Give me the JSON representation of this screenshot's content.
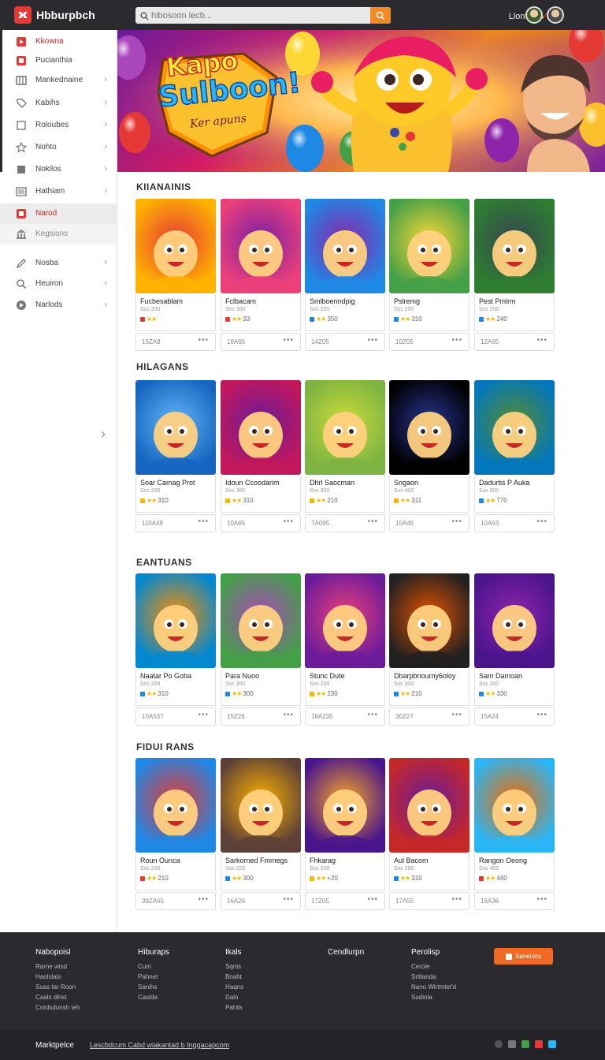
{
  "header": {
    "logo_text": "Hbburpbch",
    "search_placeholder": "hibosoon lecb...",
    "top_link": "Llonws",
    "accent_color": "#f08a24"
  },
  "sidebar": {
    "items": [
      {
        "label": "Kkowna",
        "icon": "play-icon"
      },
      {
        "label": "Pucianthia",
        "icon": "store-icon"
      },
      {
        "label": "Mankednaine",
        "icon": "grid-icon"
      },
      {
        "label": "Kabihs",
        "icon": "tag-icon"
      },
      {
        "label": "Roloubes",
        "icon": "box-icon"
      },
      {
        "label": "Nohto",
        "icon": "star-icon"
      },
      {
        "label": "Nokilos",
        "icon": "square-icon"
      },
      {
        "label": "Hathiam",
        "icon": "image-icon"
      },
      {
        "label": "Narod",
        "icon": "flag-icon"
      },
      {
        "label": "Kegsions",
        "icon": "bank-icon"
      },
      {
        "label": "Nosba",
        "icon": "pen-icon"
      },
      {
        "label": "Heuiron",
        "icon": "search-icon"
      },
      {
        "label": "Narlods",
        "icon": "compass-icon"
      }
    ]
  },
  "banner": {
    "line1": "Kapo",
    "line2": "Sulboon!",
    "tagline": "Ker apuns"
  },
  "sections": [
    {
      "title": "KIIANAINIS",
      "cards": [
        {
          "name": "Fucbesablam",
          "sub": "Sxs 200",
          "rating": "",
          "count": "15ZA9",
          "badge": "#e53935"
        },
        {
          "name": "Fclbacam",
          "sub": "Sxs 300",
          "rating": "33",
          "count": "16A65",
          "badge": "#e53935"
        },
        {
          "name": "Smlboenndpig",
          "sub": "Sxs 220",
          "rating": "350",
          "count": "14Z05",
          "badge": "#1e88e5"
        },
        {
          "name": "Pslremg",
          "sub": "Sxs 200",
          "rating": "310",
          "count": "10Z05",
          "badge": "#1e88e5"
        },
        {
          "name": "Pest Pmirm",
          "sub": "Sxs 200",
          "rating": "240",
          "count": "12A65",
          "badge": "#1e88e5"
        }
      ]
    },
    {
      "title": "HILAGANS",
      "cards": [
        {
          "name": "Soar Camag Prot",
          "sub": "Sxs 200",
          "rating": "310",
          "count": "110A49",
          "badge": "#f5b800"
        },
        {
          "name": "Idoun Ccoodarim",
          "sub": "Sxs 300",
          "rating": "310",
          "count": "10A65",
          "badge": "#f5b800"
        },
        {
          "name": "Dhrl Saocman",
          "sub": "Sxs 300",
          "rating": "210",
          "count": "7A095",
          "badge": "#f5b800"
        },
        {
          "name": "Sngaon",
          "sub": "Sxs 400",
          "rating": "311",
          "count": "10A46",
          "badge": "#f5b800"
        },
        {
          "name": "Dadurtis P Auka",
          "sub": "Sxs 500",
          "rating": "770",
          "count": "10A63",
          "badge": "#1e88e5"
        }
      ]
    },
    {
      "title": "EANTUANS",
      "cards": [
        {
          "name": "Naatar Po Goba",
          "sub": "Sxs 200",
          "rating": "310",
          "count": "10A537",
          "badge": "#1e88e5"
        },
        {
          "name": "Para Nuoo",
          "sub": "Sxs 300",
          "rating": "300",
          "count": "15Z26",
          "badge": "#1e88e5"
        },
        {
          "name": "Stunc Dute",
          "sub": "Sxs 200",
          "rating": "230",
          "count": "18A235",
          "badge": "#f5b800"
        },
        {
          "name": "Dbarpbnourny6oloy",
          "sub": "Sxs 300",
          "rating": "210",
          "count": "30Z27",
          "badge": "#1e88e5"
        },
        {
          "name": "Sam Damoan",
          "sub": "Sxs 200",
          "rating": "330",
          "count": "15A24",
          "badge": "#1e88e5"
        }
      ]
    },
    {
      "title": "FIDUI RANS",
      "cards": [
        {
          "name": "Roun Ounca",
          "sub": "Sxs 200",
          "rating": "210",
          "count": "38ZA65",
          "badge": "#e53935"
        },
        {
          "name": "Sarkorned Fmmegs",
          "sub": "Sxs 200",
          "rating": "300",
          "count": "16A26",
          "badge": "#1e88e5"
        },
        {
          "name": "Fhkarag",
          "sub": "Sxs 200",
          "rating": "+20",
          "count": "17Z05",
          "badge": "#f5b800"
        },
        {
          "name": "Aul Bacom",
          "sub": "Sxs 200",
          "rating": "310",
          "count": "17A55",
          "badge": "#1e88e5"
        },
        {
          "name": "Rangon Oeong",
          "sub": "Sxs 400",
          "rating": "440",
          "count": "16A36",
          "badge": "#e53935"
        }
      ]
    }
  ],
  "footer": {
    "columns": [
      {
        "head": "Nabopoisl",
        "links": [
          "Rarne wisd",
          "Haolslals",
          "Suas tar Roon",
          "Caals dihst",
          "Cordsdonsh teh"
        ]
      },
      {
        "head": "Hiburaps",
        "links": [
          "Cum",
          "Pahnet",
          "Sanihs",
          "Caslda"
        ]
      },
      {
        "head": "Ikals",
        "links": [
          "Sqnis",
          "Bnaht",
          "Haqns",
          "Dalo",
          "Pahlis"
        ]
      },
      {
        "head": "Cendlurpn",
        "links": []
      },
      {
        "head": "Perolisp",
        "links": [
          "Cerole",
          "Sritlanda",
          "Nano Wirtmtet'd",
          "Sudiola"
        ]
      }
    ],
    "button_label": "Sanelocs",
    "brand": "Marktpelce",
    "copyright": "Lescbdcum Cabd wiakantad b Inggacapcom"
  }
}
